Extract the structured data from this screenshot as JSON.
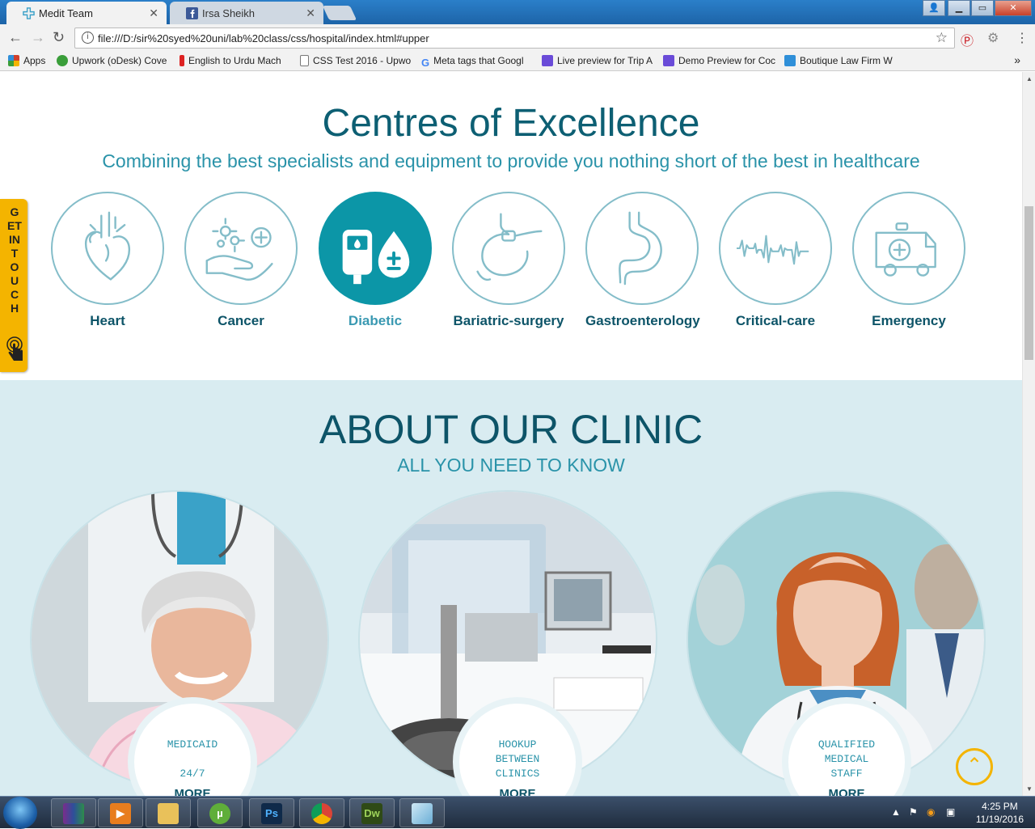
{
  "browser": {
    "tabs": [
      {
        "title": "Medit Team",
        "active": true
      },
      {
        "title": "Irsa Sheikh",
        "active": false
      }
    ],
    "url": "file:///D:/sir%20syed%20uni/lab%20class/css/hospital/index.html#upper",
    "bookmarks": [
      {
        "label": "Apps",
        "icon_color": "#d0402b"
      },
      {
        "label": "Upwork (oDesk) Cove",
        "icon_color": "#3a9e3a"
      },
      {
        "label": "English to Urdu Mach",
        "icon_color": "#d22"
      },
      {
        "label": "CSS Test 2016 - Upwo",
        "icon_color": "#999"
      },
      {
        "label": "Meta tags that Googl",
        "icon_color": "#4285f4"
      },
      {
        "label": "Live preview for Trip A",
        "icon_color": "#6a4bd8"
      },
      {
        "label": "Demo Preview for Coc",
        "icon_color": "#6a4bd8"
      },
      {
        "label": "Boutique Law Firm W",
        "icon_color": "#2f8fd8"
      }
    ]
  },
  "centres": {
    "title": "Centres of Excellence",
    "subtitle": "Combining the best specialists and equipment to provide you nothing short of the best in healthcare",
    "services": [
      {
        "label": "Heart",
        "icon": "heart-organ-icon",
        "active": false
      },
      {
        "label": "Cancer",
        "icon": "cancer-cells-icon",
        "active": false
      },
      {
        "label": "Diabetic",
        "icon": "glucose-meter-icon",
        "active": true
      },
      {
        "label": "Bariatric-surgery",
        "icon": "stomach-band-icon",
        "active": false
      },
      {
        "label": "Gastroenterology",
        "icon": "stomach-icon",
        "active": false
      },
      {
        "label": "Critical-care",
        "icon": "heartbeat-line-icon",
        "active": false
      },
      {
        "label": "Emergency",
        "icon": "ambulance-icon",
        "active": false
      }
    ]
  },
  "get_in_touch": {
    "label": "GET IN TOUCH",
    "icon": "pointing-hand-icon"
  },
  "about": {
    "title": "ABOUT OUR CLINIC",
    "subtitle": "ALL YOU NEED TO KNOW",
    "cards": [
      {
        "badge_text": "MEDICAID\n\n24/7",
        "more": "MORE",
        "image": "elderly-patient-with-doctor"
      },
      {
        "badge_text": "HOOKUP\nBETWEEN\nCLINICS",
        "more": "MORE",
        "image": "laboratory-equipment"
      },
      {
        "badge_text": "QUALIFIED\nMEDICAL\nSTAFF",
        "more": "MORE",
        "image": "female-doctor"
      }
    ]
  },
  "taskbar": {
    "time": "4:25 PM",
    "date": "11/19/2016",
    "apps": [
      "winrar-icon",
      "media-player-icon",
      "file-explorer-icon",
      "utorrent-icon",
      "photoshop-icon",
      "chrome-icon",
      "dreamweaver-icon",
      "screenshot-tool-icon"
    ]
  },
  "colors": {
    "primary_dark": "#0d5468",
    "primary_light": "#2a93a9",
    "accent_teal": "#0c96a7",
    "icon_stroke": "#84bdc9",
    "about_bg": "#d9ecf1",
    "accent_yellow": "#f4b400"
  }
}
